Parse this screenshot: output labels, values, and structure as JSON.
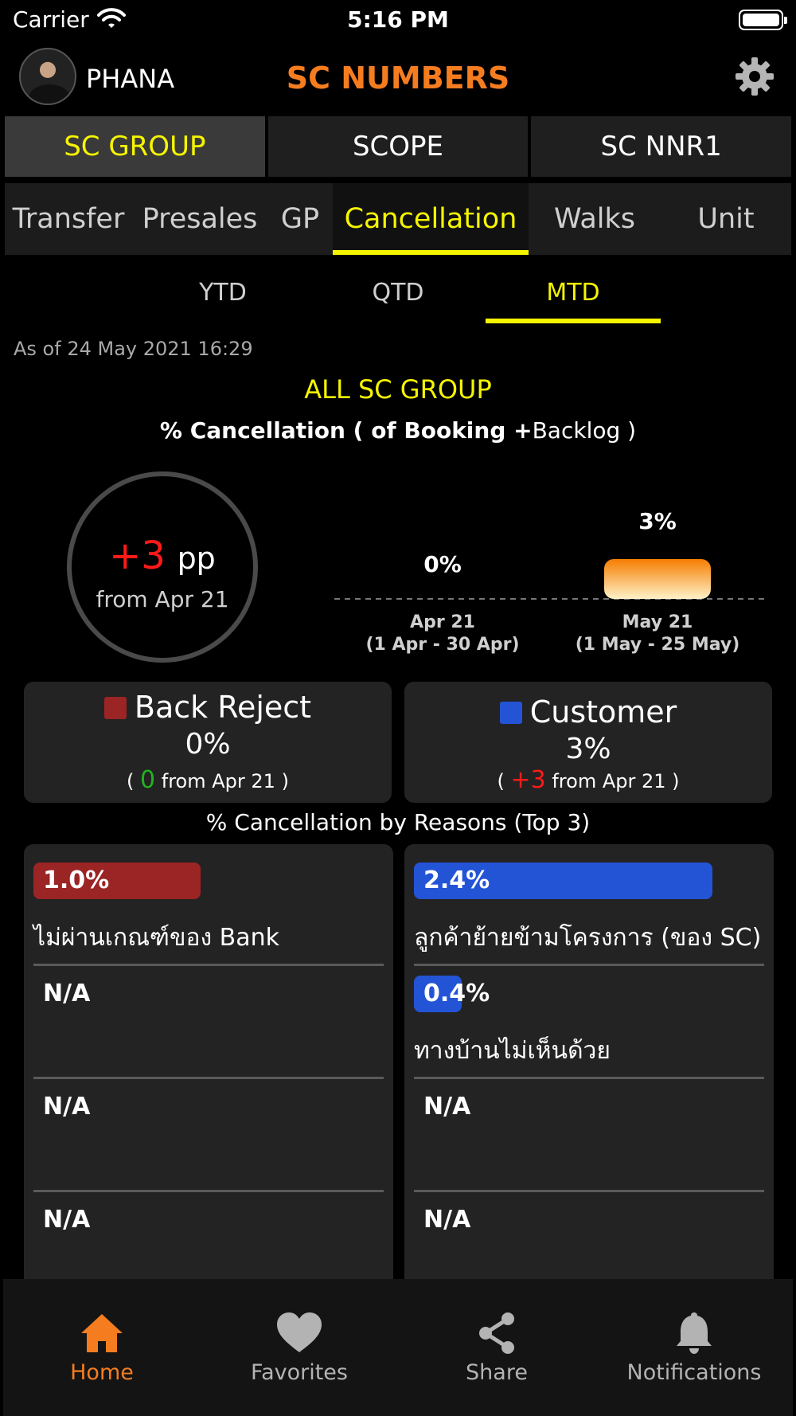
{
  "status_bar": {
    "carrier": "Carrier",
    "time": "5:16 PM"
  },
  "header": {
    "username": "PHANA",
    "title": "SC NUMBERS"
  },
  "group_tabs": [
    {
      "label": "SC GROUP",
      "active": true
    },
    {
      "label": "SCOPE",
      "active": false
    },
    {
      "label": "SC NNR1",
      "active": false
    }
  ],
  "metric_tabs": [
    {
      "label": "Transfer",
      "active": false
    },
    {
      "label": "Presales",
      "active": false
    },
    {
      "label": "GP",
      "active": false
    },
    {
      "label": "Cancellation",
      "active": true
    },
    {
      "label": "Walks",
      "active": false
    },
    {
      "label": "Unit",
      "active": false
    }
  ],
  "period_tabs": [
    {
      "label": "YTD",
      "active": false
    },
    {
      "label": "QTD",
      "active": false
    },
    {
      "label": "MTD",
      "active": true
    }
  ],
  "as_of": "As of 24 May 2021 16:29",
  "group_title": "ALL SC GROUP",
  "chart_title": {
    "prefix": "% Cancellation ( of Booking +",
    "suffix": "Backlog )"
  },
  "change_ring": {
    "value": "+3",
    "unit": "pp",
    "from": "from Apr 21"
  },
  "chart_data": {
    "type": "bar",
    "categories": [
      "Apr 21",
      "May 21"
    ],
    "category_ranges": [
      "(1 Apr - 30 Apr)",
      "(1 May - 25 May)"
    ],
    "values": [
      0,
      3
    ],
    "value_labels": [
      "0%",
      "3%"
    ],
    "ylabel": "",
    "xlabel": ""
  },
  "categories": [
    {
      "name": "Back Reject",
      "value": "0%",
      "delta": "0",
      "change_prefix": "( ",
      "change_suffix": " from Apr 21 )",
      "color": "#9b2424",
      "delta_color": "#1fb31f"
    },
    {
      "name": "Customer",
      "value": "3%",
      "delta": "+3",
      "change_prefix": "( ",
      "change_suffix": " from Apr 21 )",
      "color": "#2454d6",
      "delta_color": "#ff1a1a"
    }
  ],
  "reasons_title": "% Cancellation by Reasons (Top 3)",
  "reasons": {
    "back_reject": {
      "color": "#9b2424",
      "items": [
        {
          "pct": "1.0%",
          "label": "ไม่ผ่านเกณฑ์ของ Bank",
          "fraction": 0.42
        },
        {
          "na": "N/A"
        },
        {
          "na": "N/A"
        },
        {
          "na": "N/A"
        }
      ]
    },
    "customer": {
      "color": "#2454d6",
      "items": [
        {
          "pct": "2.4%",
          "label": "ลูกค้าย้ายข้ามโครงการ (ของ SC)",
          "fraction": 0.75
        },
        {
          "pct": "0.4%",
          "label": "ทางบ้านไม่เห็นด้วย",
          "fraction": 0.12
        },
        {
          "na": "N/A"
        },
        {
          "na": "N/A"
        }
      ]
    }
  },
  "nav": [
    {
      "label": "Home",
      "icon": "home-icon",
      "active": true
    },
    {
      "label": "Favorites",
      "icon": "heart-icon",
      "active": false
    },
    {
      "label": "Share",
      "icon": "share-icon",
      "active": false
    },
    {
      "label": "Notifications",
      "icon": "bell-icon",
      "active": false
    }
  ],
  "colors": {
    "accent": "#f57d20",
    "highlight": "#f5f500",
    "negative": "#ff1a1a",
    "positive": "#1fb31f"
  }
}
